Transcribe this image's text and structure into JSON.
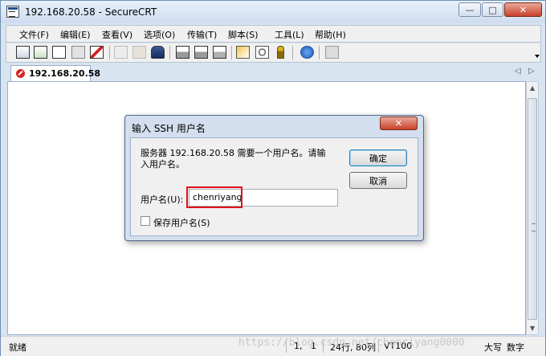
{
  "window": {
    "title": "192.168.20.58 - SecureCRT",
    "min_glyph": "—",
    "max_glyph": "□",
    "close_glyph": "✕"
  },
  "menu": [
    {
      "label": "文件(F)"
    },
    {
      "label": "编辑(E)"
    },
    {
      "label": "查看(V)"
    },
    {
      "label": "选项(O)"
    },
    {
      "label": "传输(T)"
    },
    {
      "label": "脚本(S)"
    },
    {
      "label": "工具(L)"
    },
    {
      "label": "帮助(H)"
    }
  ],
  "toolbar": {
    "icons": [
      "connect-icon",
      "quick-connect-icon",
      "connect-tab-icon",
      "reconnect-icon",
      "disconnect-icon",
      "copy-icon",
      "paste-icon",
      "find-icon",
      "print-icon",
      "print-selection-icon",
      "print-setup-icon",
      "session-options-icon",
      "global-options-icon",
      "keymap-icon",
      "help-icon",
      "sftp-icon"
    ]
  },
  "tabs": [
    {
      "label": "192.168.20.58"
    }
  ],
  "tab_nav": {
    "prev": "◁",
    "next": "▷"
  },
  "scrollbar": {
    "up": "▲",
    "down": "▼"
  },
  "dialog": {
    "title": "输入 SSH 用户名",
    "close_glyph": "✕",
    "message": "服务器 192.168.20.58 需要一个用户名。请输入用户名。",
    "ok_label": "确定",
    "cancel_label": "取消",
    "username_label": "用户名(U):",
    "username_value": "chenriyang",
    "save_username_label": "保存用户名(S)",
    "save_username_checked": false
  },
  "status": {
    "state": "就绪",
    "cursor": "1,   1",
    "size": "24行, 80列",
    "terminal": "VT100",
    "caps": "大写",
    "num": "数字"
  },
  "watermark": "https://blog.csdn.net/chenriyang0000"
}
